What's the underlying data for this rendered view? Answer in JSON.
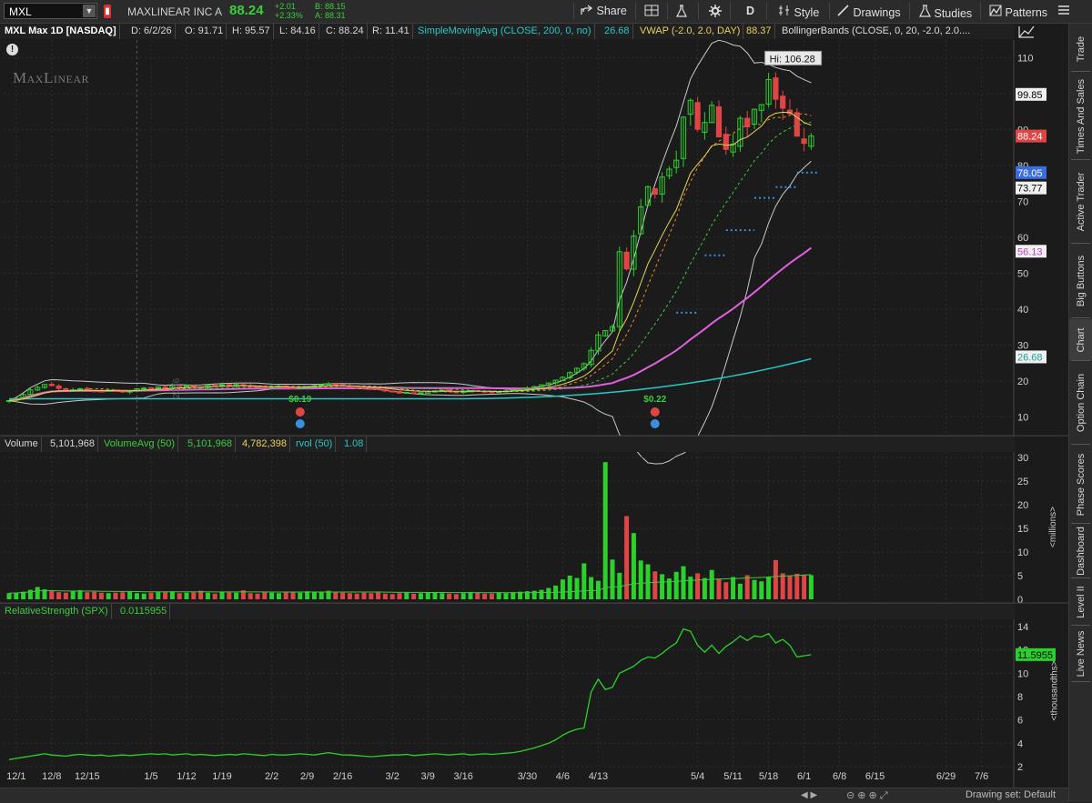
{
  "toolbar": {
    "symbol": "MXL",
    "company": "MAXLINEAR INC A",
    "last": "88.24",
    "change": "+2.01",
    "change_pct": "+2.33%",
    "bid": "B: 88.15",
    "ask": "A: 88.31",
    "share": "Share",
    "period": "D",
    "style": "Style",
    "drawings": "Drawings",
    "studies": "Studies",
    "patterns": "Patterns"
  },
  "infobar": {
    "title": "MXL Max 1D [NASDAQ]",
    "date": "D: 6/2/26",
    "open": "O: 91.71",
    "high": "H: 95.57",
    "low": "L: 84.16",
    "close": "C: 88.24",
    "range": "R: 11.41",
    "sma_label": "SimpleMovingAvg (CLOSE, 200, 0, no)",
    "sma_value": "26.68",
    "vwap_label": "VWAP (-2.0, 2.0, DAY)",
    "vwap_value": "88.37",
    "bb_label": "BollingerBands (CLOSE, 0, 20, -2.0, 2.0...."
  },
  "logo_text": "MaxLinear",
  "watermark_year": "2026",
  "volume_bar": {
    "label": "Volume",
    "value": "5,101,968",
    "avg_label": "VolumeAvg (50)",
    "avg_value": "5,101,968",
    "avg_value2": "4,782,398",
    "rvol_label": "rvol (50)",
    "rvol_value": "1.08"
  },
  "rs_bar": {
    "label": "RelativeStrength (SPX)",
    "value": "0.0115955"
  },
  "right_nav": [
    "Trade",
    "Times And Sales",
    "Active Trader",
    "Big Buttons",
    "Chart",
    "Option Chain",
    "Phase Scores",
    "Dashboard",
    "Level II",
    "Live News"
  ],
  "bottom": {
    "drawing_set": "Drawing set: Default"
  },
  "axis_unit_volume": "<millions>",
  "axis_unit_rs": "<thousandths>",
  "colors": {
    "up": "#2bd12b",
    "down": "#e04545",
    "sma200": "#27c8c8",
    "sma50": "#e060e0",
    "bollinger": "#c8c8c8",
    "vwap": "#e8d25a"
  },
  "chart_data": [
    {
      "type": "candlestick",
      "title": "MXL Max 1D [NASDAQ]",
      "x_tick_labels": [
        "12/1",
        "12/8",
        "12/15",
        "1/5",
        "1/12",
        "1/19",
        "2/2",
        "2/9",
        "2/16",
        "3/2",
        "3/9",
        "3/16",
        "3/30",
        "4/6",
        "4/13",
        "5/4",
        "5/11",
        "5/18",
        "6/1",
        "6/8",
        "6/15",
        "6/29",
        "7/6"
      ],
      "ylim": [
        5,
        115
      ],
      "y_ticks": [
        10,
        20,
        30,
        40,
        50,
        60,
        70,
        80,
        90,
        100,
        110
      ],
      "annotations": [
        {
          "text": "Hi: 106.28",
          "value": 106.28
        },
        {
          "text": "$0.19",
          "date": "1/26"
        },
        {
          "text": "$0.22",
          "date": "4/20"
        }
      ],
      "price_badges": [
        {
          "label": "99.85",
          "value": 99.85
        },
        {
          "label": "88.24",
          "value": 88.24
        },
        {
          "label": "78.05",
          "value": 78.05
        },
        {
          "label": "73.77",
          "value": 73.77
        },
        {
          "label": "56.13",
          "value": 56.13
        },
        {
          "label": "26.68",
          "value": 26.68
        }
      ],
      "series": [
        {
          "name": "Close",
          "dates_start": "11/24",
          "values": [
            14.5,
            15.1,
            16.2,
            17.5,
            18.2,
            19.0,
            18.7,
            17.9,
            17.3,
            17.5,
            17.8,
            17.4,
            17.0,
            17.1,
            17.4,
            17.2,
            16.9,
            17.2,
            17.8,
            18.0,
            17.9,
            18.3,
            18.0,
            18.6,
            18.4,
            18.7,
            18.5,
            18.3,
            18.8,
            18.6,
            18.9,
            18.7,
            19.0,
            18.8,
            18.4,
            18.2,
            18.0,
            18.3,
            18.5,
            18.1,
            18.0,
            18.2,
            18.4,
            18.7,
            18.9,
            19.2,
            18.9,
            18.6,
            18.4,
            18.2,
            18.0,
            17.8,
            17.6,
            17.2,
            16.9,
            16.6,
            16.8,
            16.5,
            16.7,
            17.0,
            17.2,
            17.4,
            17.1,
            16.9,
            17.1,
            17.3,
            17.2,
            17.0,
            16.8,
            17.0,
            17.2,
            17.5,
            17.7,
            18.0,
            18.4,
            18.9,
            19.4,
            20.2,
            21.0,
            22.3,
            23.5,
            24.8,
            28.5,
            32.8,
            34.0,
            35.1,
            56.0,
            51.2,
            60.4,
            68.5,
            74.1,
            72.0,
            76.8,
            79.0,
            81.5,
            93.5,
            98.2,
            90.1,
            92.0,
            96.8,
            88.0,
            84.5,
            86.0,
            93.2,
            90.8,
            95.7,
            97.0,
            104.0,
            98.5,
            96.0,
            94.5,
            88.2,
            86.2,
            88.24
          ]
        },
        {
          "name": "SMA 200",
          "end_value": 26.68
        },
        {
          "name": "SMA 50",
          "end_value": 56.13
        },
        {
          "name": "VWAP",
          "end_value": 88.37
        }
      ]
    },
    {
      "type": "bar",
      "title": "Volume",
      "unit": "millions",
      "ylim": [
        0,
        30
      ],
      "y_ticks": [
        5,
        10,
        15,
        20,
        25,
        30
      ],
      "values": [
        1.3,
        1.4,
        1.6,
        2.0,
        2.6,
        2.1,
        1.8,
        1.5,
        1.4,
        1.7,
        1.9,
        1.5,
        1.6,
        1.4,
        1.3,
        1.4,
        1.5,
        1.6,
        1.3,
        1.2,
        1.4,
        1.5,
        1.6,
        1.7,
        1.3,
        1.4,
        1.5,
        1.8,
        1.4,
        1.2,
        1.6,
        1.5,
        1.4,
        1.9,
        1.3,
        1.2,
        1.5,
        1.4,
        1.3,
        1.6,
        1.5,
        1.4,
        1.7,
        1.6,
        1.5,
        1.8,
        1.6,
        1.4,
        1.3,
        1.2,
        1.4,
        1.3,
        1.5,
        1.2,
        1.1,
        1.3,
        1.4,
        1.2,
        1.3,
        1.4,
        1.5,
        1.3,
        1.2,
        1.1,
        1.3,
        1.5,
        1.4,
        1.2,
        1.2,
        1.4,
        1.3,
        1.5,
        1.6,
        1.7,
        1.8,
        2.0,
        2.4,
        2.9,
        4.2,
        5.0,
        4.5,
        7.6,
        4.7,
        3.9,
        29.0,
        8.4,
        5.6,
        17.6,
        14.0,
        8.2,
        7.4,
        5.9,
        5.3,
        4.4,
        5.8,
        7.0,
        4.8,
        5.5,
        4.5,
        6.2,
        4.4,
        3.6,
        4.7,
        3.3,
        5.1,
        4.1,
        3.8,
        4.8,
        8.3,
        5.5,
        4.9,
        5.4,
        5.1,
        5.1
      ]
    },
    {
      "type": "line",
      "title": "RelativeStrength (SPX)",
      "unit": "thousandths",
      "ylim": [
        2,
        14
      ],
      "y_ticks": [
        2,
        4,
        6,
        8,
        10,
        12,
        14
      ],
      "end_value": 11.5955,
      "values": [
        2.6,
        2.7,
        2.8,
        2.9,
        3.0,
        3.1,
        3.0,
        2.95,
        2.9,
        3.0,
        3.05,
        3.0,
        2.95,
        3.0,
        2.9,
        2.95,
        3.0,
        2.95,
        3.0,
        3.05,
        3.1,
        3.05,
        3.1,
        3.0,
        3.05,
        3.1,
        3.0,
        3.05,
        3.0,
        2.95,
        3.0,
        3.05,
        3.0,
        3.1,
        3.05,
        3.0,
        2.95,
        3.05,
        3.0,
        3.0,
        3.05,
        3.1,
        3.05,
        3.0,
        3.1,
        3.2,
        3.1,
        3.0,
        3.0,
        2.95,
        2.9,
        2.85,
        2.9,
        2.95,
        3.0,
        3.0,
        3.05,
        2.95,
        3.0,
        3.05,
        3.1,
        3.05,
        3.0,
        3.05,
        3.1,
        3.0,
        3.05,
        3.1,
        3.05,
        3.1,
        3.15,
        3.2,
        3.3,
        3.45,
        3.6,
        3.8,
        4.0,
        4.3,
        4.7,
        5.0,
        5.2,
        5.3,
        8.4,
        9.5,
        8.6,
        8.8,
        10.0,
        10.3,
        10.6,
        11.1,
        11.4,
        11.3,
        11.7,
        12.2,
        12.6,
        13.8,
        13.6,
        12.4,
        11.8,
        12.4,
        11.7,
        12.3,
        12.7,
        13.2,
        12.8,
        13.2,
        13.1,
        13.4,
        12.6,
        12.9,
        12.4,
        11.4,
        11.5,
        11.5955
      ]
    }
  ]
}
